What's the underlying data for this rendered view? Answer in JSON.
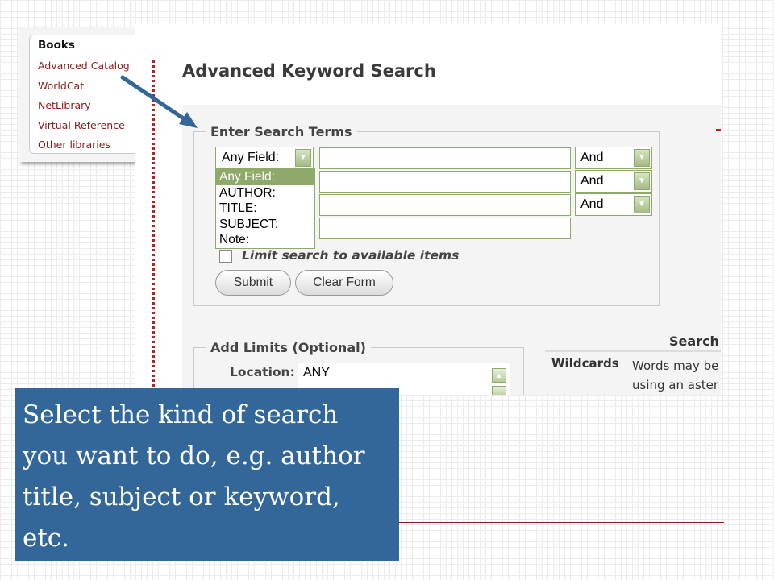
{
  "books": {
    "title": "Books",
    "links": [
      "Advanced Catalog",
      "WorldCat",
      "NetLibrary",
      "Virtual Reference",
      "Other libraries"
    ]
  },
  "page": {
    "title": "Advanced Keyword Search"
  },
  "search_terms": {
    "legend": "Enter Search Terms",
    "field_value": "Any Field:",
    "field_options": [
      "Any Field:",
      "AUTHOR:",
      "TITLE:",
      "SUBJECT:",
      "Note:"
    ],
    "selected_option": "Any Field:",
    "boolean_values": [
      "And",
      "And",
      "And"
    ],
    "terms": [
      "",
      "",
      "",
      ""
    ],
    "limit_checkbox_label": "Limit search to available items",
    "limit_checked": false,
    "submit_label": "Submit",
    "clear_label": "Clear Form"
  },
  "limits": {
    "legend": "Add Limits (Optional)",
    "location_label": "Location:",
    "location_value": "ANY"
  },
  "tips": {
    "heading": "Search",
    "rows": [
      {
        "term": "Wildcards",
        "description_lines": [
          "Words may be",
          "using an aster"
        ]
      }
    ]
  },
  "caption": {
    "text": "Select the kind of  search you want to do, e.g. author title, subject or keyword, etc."
  },
  "colors": {
    "caption_bg": "#336699",
    "link_color": "#8b1a1a",
    "arrow_color": "#336699",
    "select_border": "#8fa96a",
    "separator": "#b22222"
  },
  "icons": [
    "chevron-down-icon",
    "chevron-up-icon",
    "pointer-arrow-icon"
  ]
}
